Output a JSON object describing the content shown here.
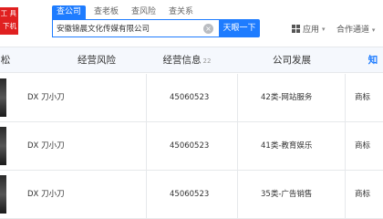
{
  "header": {
    "logo_line1": "工 具",
    "logo_line2": "下机构",
    "tabs": [
      {
        "label": "查公司",
        "active": true
      },
      {
        "label": "查老板",
        "active": false
      },
      {
        "label": "查风险",
        "active": false
      },
      {
        "label": "查关系",
        "active": false
      }
    ],
    "search": {
      "value": "安徽锦晨文化传媒有限公司",
      "button_label": "天眼一下"
    },
    "nav": {
      "apps_label": "应用",
      "channel_label": "合作通道"
    }
  },
  "table": {
    "columns": [
      {
        "label": "松"
      },
      {
        "label": "经营风险"
      },
      {
        "label": "经营信息",
        "badge": "22"
      },
      {
        "label": "公司发展"
      },
      {
        "label": "知"
      }
    ],
    "rows": [
      {
        "name": "DX 刀小刀",
        "reg_no": "45060523",
        "category": "42类-网站服务",
        "status": "商标"
      },
      {
        "name": "DX 刀小刀",
        "reg_no": "45060523",
        "category": "41类-教育娱乐",
        "status": "商标"
      },
      {
        "name": "DX 刀小刀",
        "reg_no": "45060523",
        "category": "35类-广告销售",
        "status": "商标"
      }
    ]
  }
}
